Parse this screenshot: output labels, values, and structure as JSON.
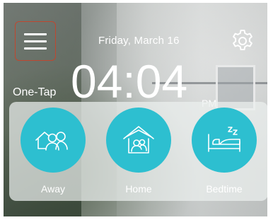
{
  "header": {
    "date": "Friday, March 16",
    "menu_icon": "hamburger-menu-icon",
    "settings_icon": "gear-icon"
  },
  "clock": {
    "time": "04:04",
    "period": "PM",
    "caption": "One-Tap"
  },
  "modes": [
    {
      "label": "Away",
      "icon": "away-people-icon"
    },
    {
      "label": "Home",
      "icon": "home-icon"
    },
    {
      "label": "Bedtime",
      "icon": "bed-icon"
    }
  ],
  "colors": {
    "accent": "#2dbfd0",
    "menu_border": "#c0472f",
    "text": "#ffffff"
  }
}
